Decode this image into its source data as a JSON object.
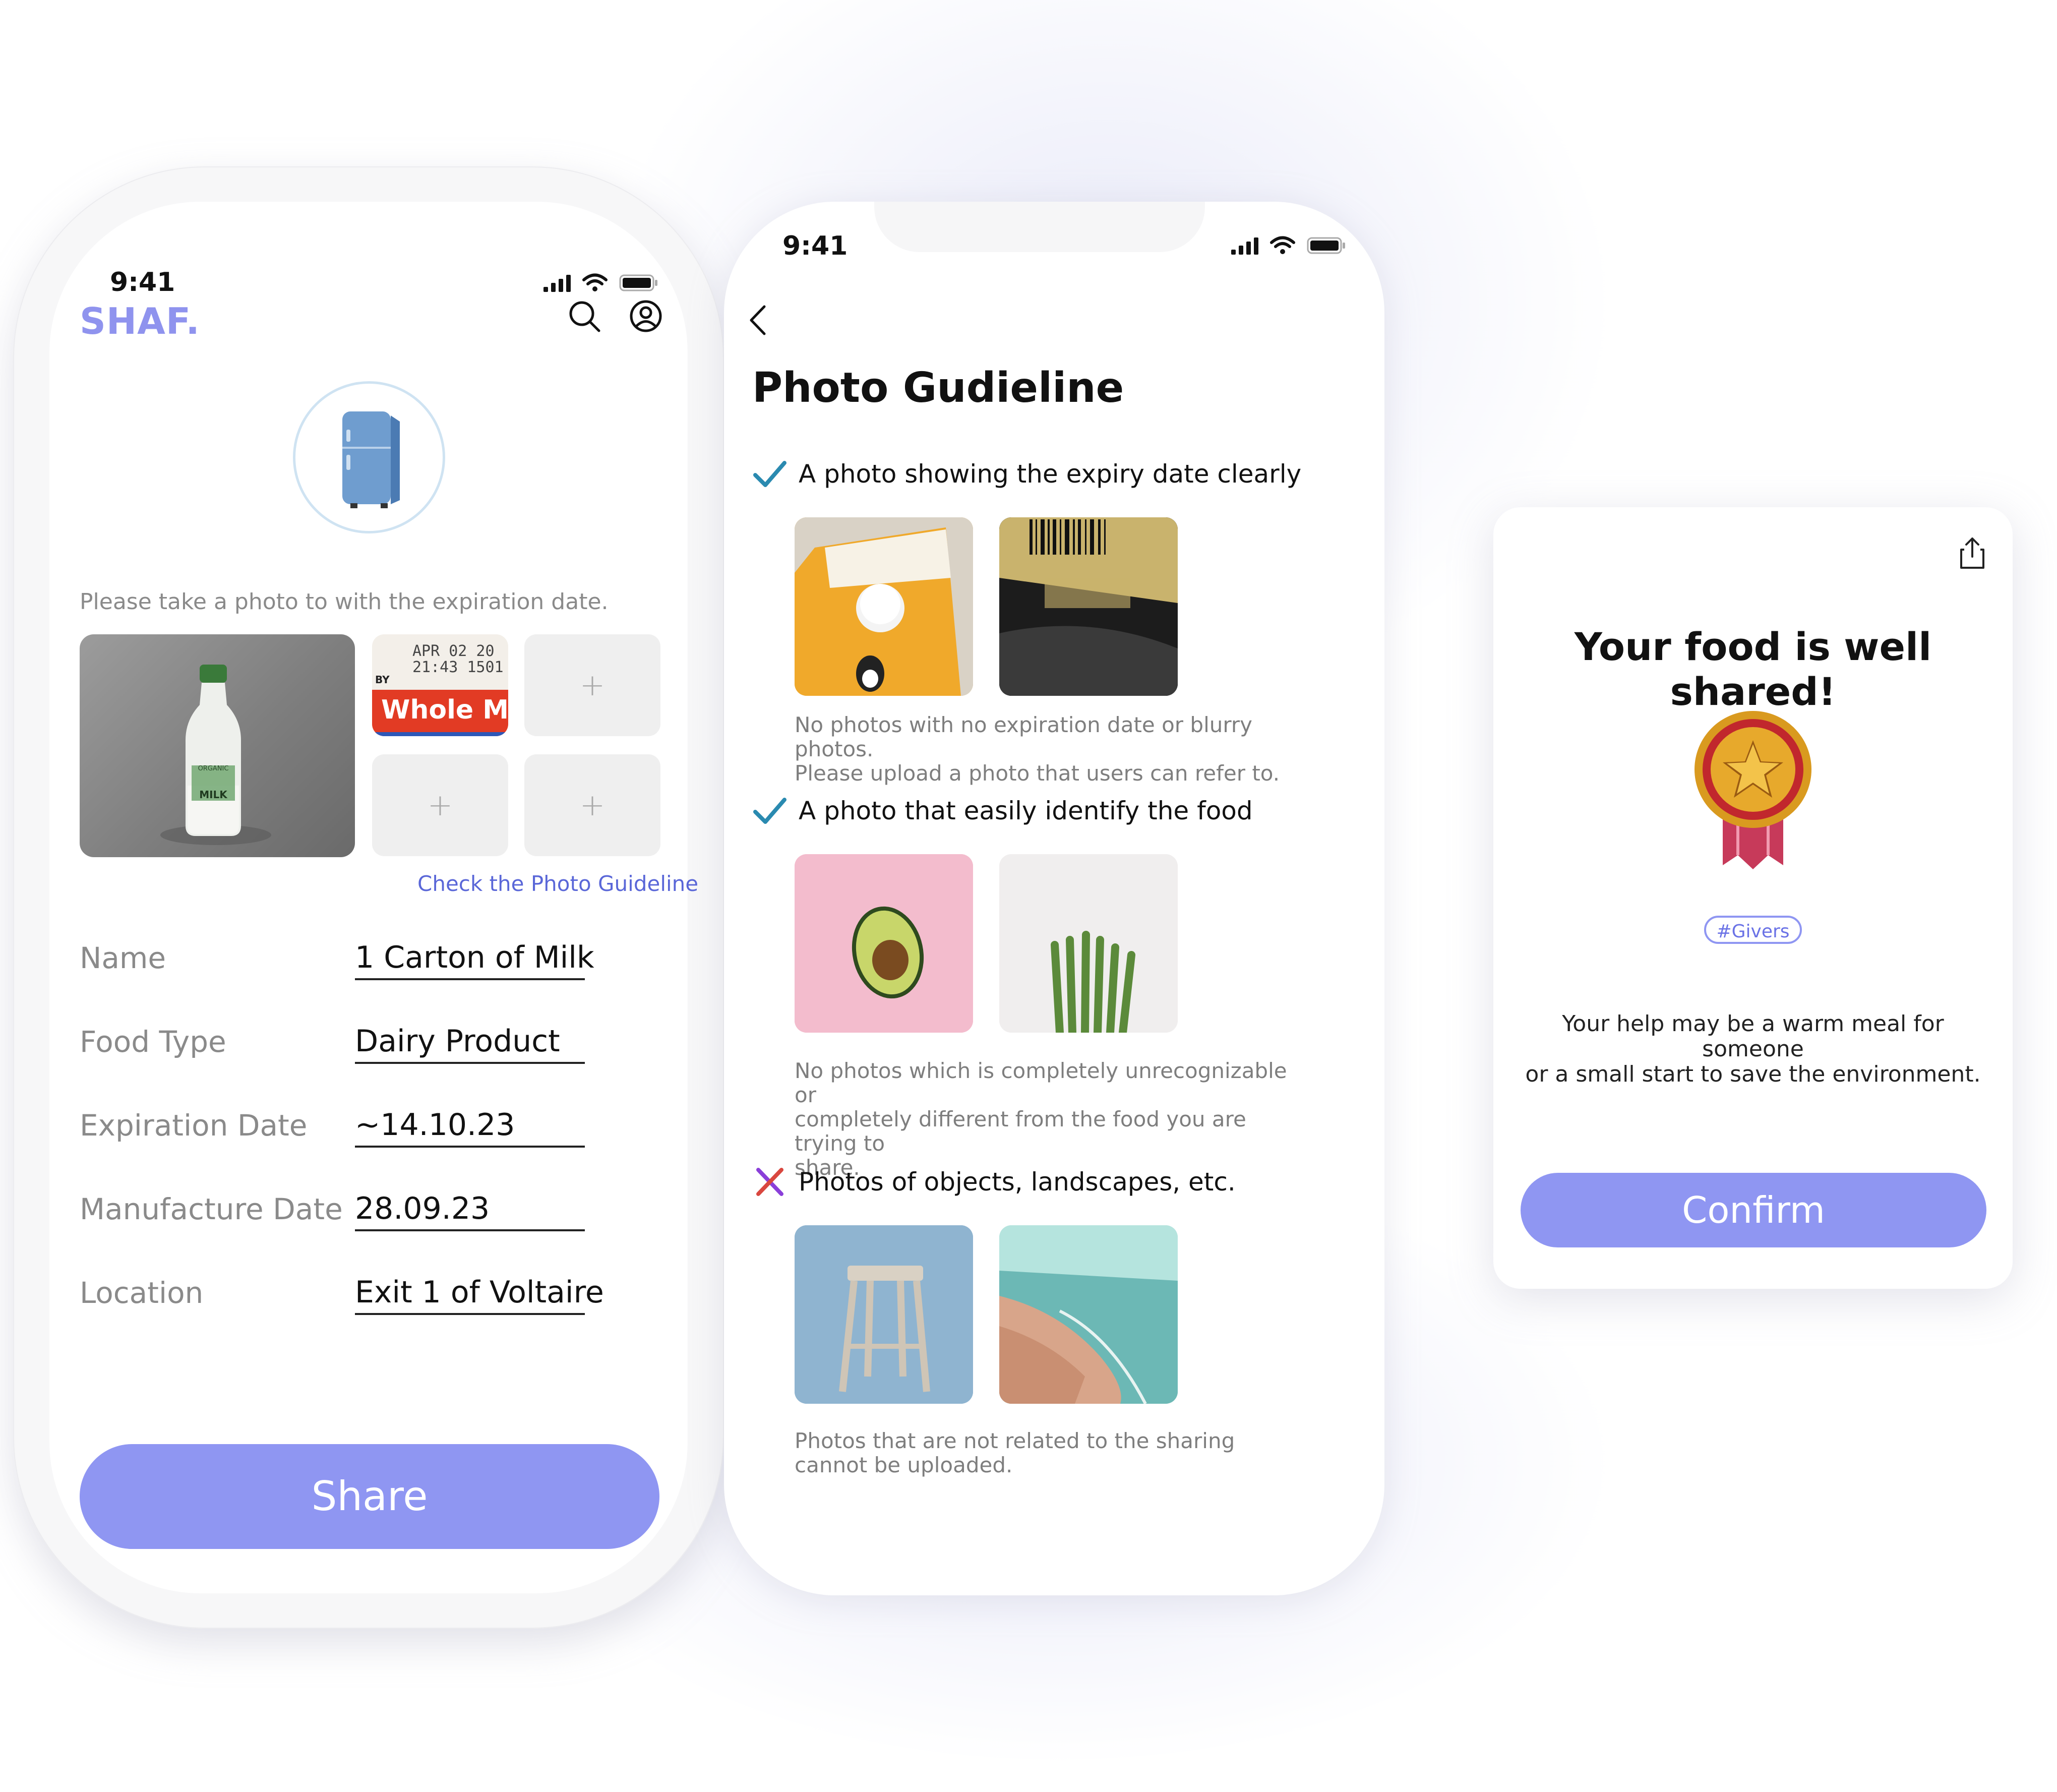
{
  "colors": {
    "brand": "#8f96f2",
    "brand_text": "#8f93ee",
    "link": "#5a67d8",
    "check": "#2a8ab0",
    "cross": "#7a45d9"
  },
  "phone1": {
    "status_time": "9:41",
    "logo": "SHAF.",
    "icons": [
      "search-icon",
      "profile-icon",
      "fridge-icon"
    ],
    "instruction": "Please take a photo to with the expiration date.",
    "label_photo": {
      "stamp_line1": "APR 02 20",
      "stamp_line2": "21:43 1501",
      "stamp_prefix": "BY",
      "band_text": "Whole Mil"
    },
    "bottle_label": [
      "ORGANIC",
      "MILK"
    ],
    "add_slot": "+",
    "guideline_link": "Check the Photo Guideline",
    "fields": [
      {
        "label": "Name",
        "value": "1 Carton of Milk"
      },
      {
        "label": "Food Type",
        "value": "Dairy Product"
      },
      {
        "label": "Expiration Date",
        "value": "~14.10.23"
      },
      {
        "label": "Manufacture Date",
        "value": "28.09.23"
      },
      {
        "label": "Location",
        "value": "Exit 1 of Voltaire"
      }
    ],
    "share_button": "Share"
  },
  "phone2": {
    "status_time": "9:41",
    "title": "Photo Gudieline",
    "sections": [
      {
        "icon": "check-icon",
        "heading": "A photo showing the expiry date clearly",
        "note_line1": "No photos with no expiration date or blurry photos.",
        "note_line2": "Please upload a photo that users can refer to."
      },
      {
        "icon": "check-icon",
        "heading": "A photo that easily identify the food",
        "note_line1": "No photos which is completely unrecognizable or",
        "note_line2": "completely different from the food you are trying to",
        "note_line3": "share."
      },
      {
        "icon": "cross-icon",
        "heading": "Photos of objects, landscapes, etc.",
        "note_line1": "Photos that are not related to the sharing",
        "note_line2": "cannot be uploaded."
      }
    ]
  },
  "card": {
    "title": "Your food is well shared!",
    "tag": "#Givers",
    "desc_line1": "Your help may be a warm meal for someone",
    "desc_line2": "or a small start to save the environment.",
    "confirm_button": "Confirm",
    "icons": [
      "share-icon",
      "medal-icon"
    ]
  }
}
